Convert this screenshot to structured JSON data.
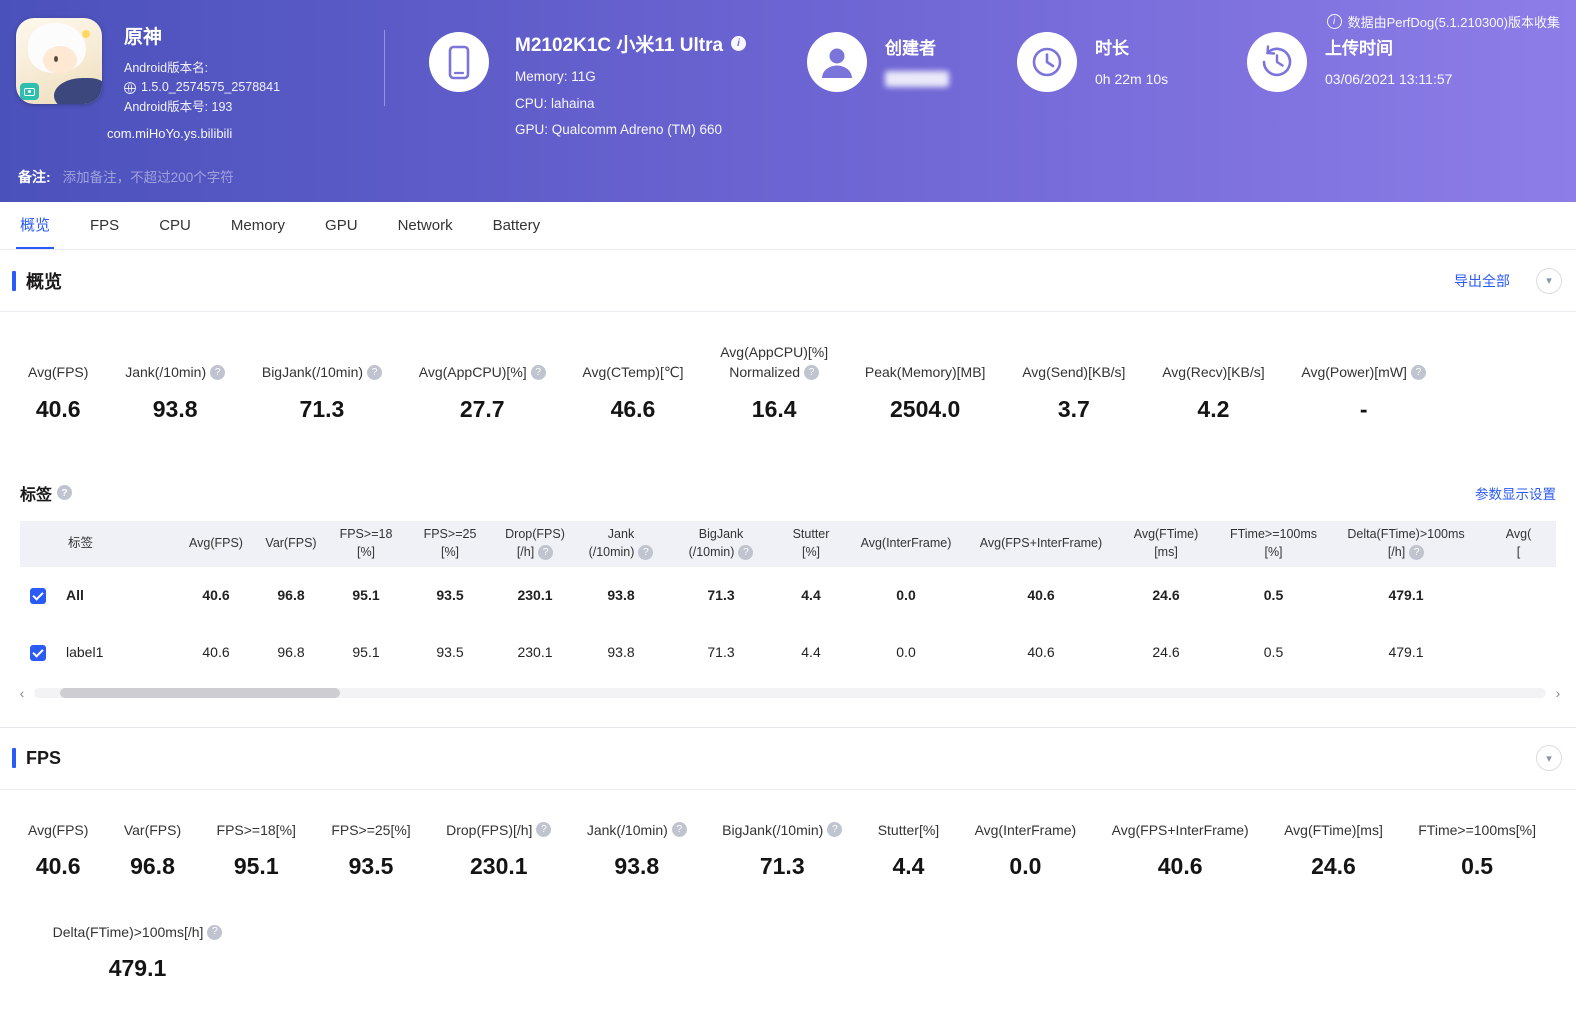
{
  "colors": {
    "accent": "#2b5bf7",
    "header_gradient_start": "#4b51bb",
    "header_gradient_end": "#8d7de8"
  },
  "icons": {
    "info": "i",
    "help": "?",
    "collapse": "▾",
    "scroll_left": "‹",
    "scroll_right": "›"
  },
  "header": {
    "collect_info": "数据由PerfDog(5.1.210300)版本收集",
    "app": {
      "name": "原神",
      "version_name_label": "Android版本名:",
      "version_name": "1.5.0_2574575_2578841",
      "version_code_label": "Android版本号: 193",
      "package": "com.miHoYo.ys.bilibili"
    },
    "device": {
      "model": "M2102K1C 小米11 Ultra",
      "memory": "Memory: 11G",
      "cpu": "CPU: lahaina",
      "gpu": "GPU: Qualcomm Adreno (TM) 660"
    },
    "creator_label": "创建者",
    "duration_label": "时长",
    "duration_value": "0h 22m 10s",
    "upload_label": "上传时间",
    "upload_value": "03/06/2021 13:11:57",
    "note_label": "备注:",
    "note_placeholder": "添加备注，不超过200个字符"
  },
  "tabs": [
    {
      "label": "概览",
      "active": true
    },
    {
      "label": "FPS",
      "active": false
    },
    {
      "label": "CPU",
      "active": false
    },
    {
      "label": "Memory",
      "active": false
    },
    {
      "label": "GPU",
      "active": false
    },
    {
      "label": "Network",
      "active": false
    },
    {
      "label": "Battery",
      "active": false
    }
  ],
  "overview": {
    "title": "概览",
    "export_all_label": "导出全部",
    "metrics": [
      {
        "label": "Avg(FPS)",
        "value": "40.6",
        "help": false
      },
      {
        "label": "Jank(/10min)",
        "value": "93.8",
        "help": true
      },
      {
        "label": "BigJank(/10min)",
        "value": "71.3",
        "help": true
      },
      {
        "label": "Avg(AppCPU)[%]",
        "value": "27.7",
        "help": true
      },
      {
        "label": "Avg(CTemp)[℃]",
        "value": "46.6",
        "help": false
      },
      {
        "label": "Avg(AppCPU)[%]",
        "label2": "Normalized",
        "value": "16.4",
        "help": true
      },
      {
        "label": "Peak(Memory)[MB]",
        "value": "2504.0",
        "help": false
      },
      {
        "label": "Avg(Send)[KB/s]",
        "value": "3.7",
        "help": false
      },
      {
        "label": "Avg(Recv)[KB/s]",
        "value": "4.2",
        "help": false
      },
      {
        "label": "Avg(Power)[mW]",
        "value": "-",
        "help": true
      }
    ]
  },
  "labels": {
    "title": "标签",
    "settings_label": "参数显示设置",
    "columns": [
      {
        "line1": "标签",
        "line2": "",
        "help": false
      },
      {
        "line1": "Avg(FPS)",
        "line2": "",
        "help": false
      },
      {
        "line1": "Var(FPS)",
        "line2": "",
        "help": false
      },
      {
        "line1": "FPS>=18",
        "line2": "[%]",
        "help": false
      },
      {
        "line1": "FPS>=25",
        "line2": "[%]",
        "help": false
      },
      {
        "line1": "Drop(FPS)",
        "line2": "[/h]",
        "help": true
      },
      {
        "line1": "Jank",
        "line2": "(/10min)",
        "help": true
      },
      {
        "line1": "BigJank",
        "line2": "(/10min)",
        "help": true
      },
      {
        "line1": "Stutter",
        "line2": "[%]",
        "help": false
      },
      {
        "line1": "Avg(InterFrame)",
        "line2": "",
        "help": false
      },
      {
        "line1": "Avg(FPS+InterFrame)",
        "line2": "",
        "help": false
      },
      {
        "line1": "Avg(FTime)",
        "line2": "[ms]",
        "help": false
      },
      {
        "line1": "FTime>=100ms",
        "line2": "[%]",
        "help": false
      },
      {
        "line1": "Delta(FTime)>100ms",
        "line2": "[/h]",
        "help": true
      },
      {
        "line1": "Avg(",
        "line2": "[",
        "help": false
      }
    ],
    "rows": [
      {
        "checked": true,
        "bold": true,
        "label": "All",
        "values": [
          "40.6",
          "96.8",
          "95.1",
          "93.5",
          "230.1",
          "93.8",
          "71.3",
          "4.4",
          "0.0",
          "40.6",
          "24.6",
          "0.5",
          "479.1",
          ""
        ]
      },
      {
        "checked": true,
        "bold": false,
        "label": "label1",
        "values": [
          "40.6",
          "96.8",
          "95.1",
          "93.5",
          "230.1",
          "93.8",
          "71.3",
          "4.4",
          "0.0",
          "40.6",
          "24.6",
          "0.5",
          "479.1",
          ""
        ]
      }
    ]
  },
  "fps": {
    "title": "FPS",
    "metrics_row1": [
      {
        "label": "Avg(FPS)",
        "value": "40.6",
        "help": false
      },
      {
        "label": "Var(FPS)",
        "value": "96.8",
        "help": false
      },
      {
        "label": "FPS>=18[%]",
        "value": "95.1",
        "help": false
      },
      {
        "label": "FPS>=25[%]",
        "value": "93.5",
        "help": false
      },
      {
        "label": "Drop(FPS)[/h]",
        "value": "230.1",
        "help": true
      },
      {
        "label": "Jank(/10min)",
        "value": "93.8",
        "help": true
      },
      {
        "label": "BigJank(/10min)",
        "value": "71.3",
        "help": true
      },
      {
        "label": "Stutter[%]",
        "value": "4.4",
        "help": false
      },
      {
        "label": "Avg(InterFrame)",
        "value": "0.0",
        "help": false
      },
      {
        "label": "Avg(FPS+InterFrame)",
        "value": "40.6",
        "help": false
      },
      {
        "label": "Avg(FTime)[ms]",
        "value": "24.6",
        "help": false
      },
      {
        "label": "FTime>=100ms[%]",
        "value": "0.5",
        "help": false
      }
    ],
    "metrics_row2": [
      {
        "label": "Delta(FTime)>100ms[/h]",
        "value": "479.1",
        "help": true
      }
    ]
  }
}
